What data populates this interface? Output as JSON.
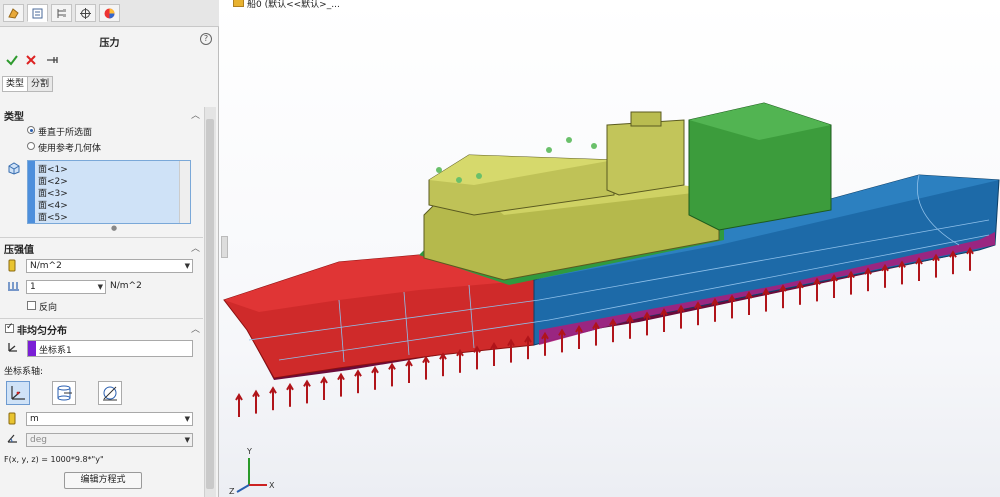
{
  "manager_tabs": [
    {
      "icon": "feature-manager-icon",
      "active": false
    },
    {
      "icon": "property-manager-icon",
      "active": true
    },
    {
      "icon": "configuration-manager-icon",
      "active": false
    },
    {
      "icon": "dimxpert-icon",
      "active": false
    },
    {
      "icon": "display-manager-icon",
      "active": false
    }
  ],
  "property_manager": {
    "title": "压力",
    "help": "?",
    "subtabs": [
      "类型",
      "分割"
    ]
  },
  "type_section": {
    "title": "类型",
    "options": [
      "垂直于所选面",
      "使用参考几何体"
    ],
    "selected_index": 0,
    "faces": [
      "面<1>",
      "面<2>",
      "面<3>",
      "面<4>",
      "面<5>"
    ]
  },
  "pressure_section": {
    "title": "压强值",
    "unit": "N/m^2",
    "value": "1",
    "value_unit": "N/m^2",
    "reverse_label": "反向",
    "reverse_checked": false
  },
  "nonuniform_section": {
    "title": "非均匀分布",
    "checked": true,
    "coordinate_system": "坐标系1",
    "axes_label": "坐标系轴:",
    "length_unit": "m",
    "angle_unit": "deg",
    "formula": "F(x, y, z) = 1000*9.8*\"y\"",
    "edit_button": "编辑方程式"
  },
  "viewport": {
    "breadcrumb": "船0 (默认<<默认>_..."
  },
  "colors": {
    "accent": "#4d8fdc",
    "hull_bow": "#d42a2a",
    "hull_stern": "#1f6fa8",
    "superstructure": "#c7c95a",
    "deckhouse_green": "#3f9a3f",
    "load_arrow": "#b0141a"
  }
}
